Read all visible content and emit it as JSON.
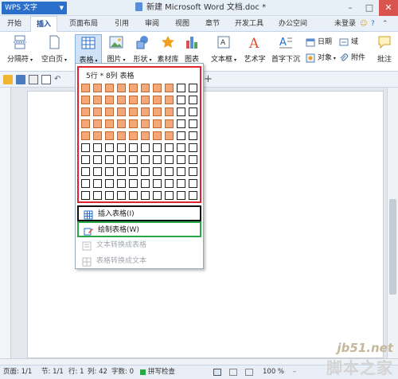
{
  "titlebar": {
    "app_label": "WPS 文字",
    "doc_title": "新建 Microsoft Word 文档.doc *"
  },
  "menu": {
    "items": [
      "开始",
      "插入",
      "页面布局",
      "引用",
      "审阅",
      "视图",
      "章节",
      "开发工具",
      "办公空间"
    ],
    "active_index": 1,
    "login": "未登录"
  },
  "ribbon": {
    "page_break": "分隔符",
    "blank_page": "空白页",
    "table": "表格",
    "picture": "图片",
    "shape": "形状",
    "material": "素材库",
    "chart": "图表",
    "textbox": "文本框",
    "wordart": "艺术字",
    "dropcap": "首字下沉",
    "date": "日期",
    "field": "域",
    "object": "对象",
    "attachment": "附件",
    "annotate": "批注"
  },
  "dropdown": {
    "grid_label": "5行 * 8列 表格",
    "grid_rows": 10,
    "grid_cols": 10,
    "selected_rows": 5,
    "selected_cols": 8,
    "insert_table": "插入表格(I)",
    "draw_table": "绘制表格(W)",
    "text_to_table": "文本转换成表格",
    "table_to_text": "表格转换成文本"
  },
  "status": {
    "page": "页面: 1/1",
    "section": "节: 1/1",
    "row": "行: 1",
    "col": "列: 42",
    "words": "字数: 0",
    "spell": "拼写检查",
    "zoom": "100 %"
  },
  "watermark": {
    "line1": "jb51.net",
    "line2": "脚本之家"
  },
  "colors": {
    "selected_cell": "#f4a87a",
    "grid_border": "#e0232e",
    "insert_box": "#111111",
    "draw_box": "#28a745",
    "accent": "#2a6fc9"
  }
}
